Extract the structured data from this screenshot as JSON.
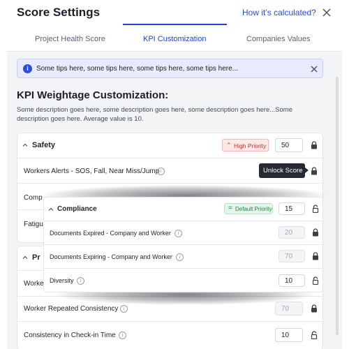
{
  "header": {
    "title": "Score Settings",
    "help_link": "How it’s calculated?",
    "close_icon": "close-icon"
  },
  "tabs": [
    {
      "label": "Project Health Score",
      "active": false
    },
    {
      "label": "KPI Customization",
      "active": true
    },
    {
      "label": "Companies Values",
      "active": false
    }
  ],
  "tip": {
    "icon": "info-icon",
    "text": "Some tips here, some tips here, some tips here, some tips here..."
  },
  "section": {
    "title": "KPI Weightage Customization:",
    "description": "Some description goes here, some description goes here, some description goes here...Some description goes here. Average value is 10."
  },
  "safety": {
    "name": "Safety",
    "priority": "High Priority",
    "value": "50",
    "rows": [
      {
        "label": "Workers Alerts - SOS, Fall, Near Miss/Jump"
      },
      {
        "label": "Comp"
      },
      {
        "label": "Fatigu"
      }
    ],
    "tooltip": "Unlock Score"
  },
  "background_section": {
    "name": "Pr",
    "rows": [
      {
        "label": "Worke"
      },
      {
        "label": "Worker Repeated Consistency",
        "value": "70"
      },
      {
        "label": "Consistency in Check-in Time",
        "value": "10"
      }
    ]
  },
  "compliance": {
    "name": "Compliance",
    "priority": "Default Priority",
    "value": "15",
    "rows": [
      {
        "label": "Documents Expired - Company and Worker",
        "value": "20"
      },
      {
        "label": "Documents Expiring - Company and Worker",
        "value": "70"
      },
      {
        "label": "Diversity",
        "value": "10"
      }
    ]
  },
  "colors": {
    "accent": "#2346c9",
    "high_priority": "#c23232",
    "default_priority": "#22804a"
  }
}
